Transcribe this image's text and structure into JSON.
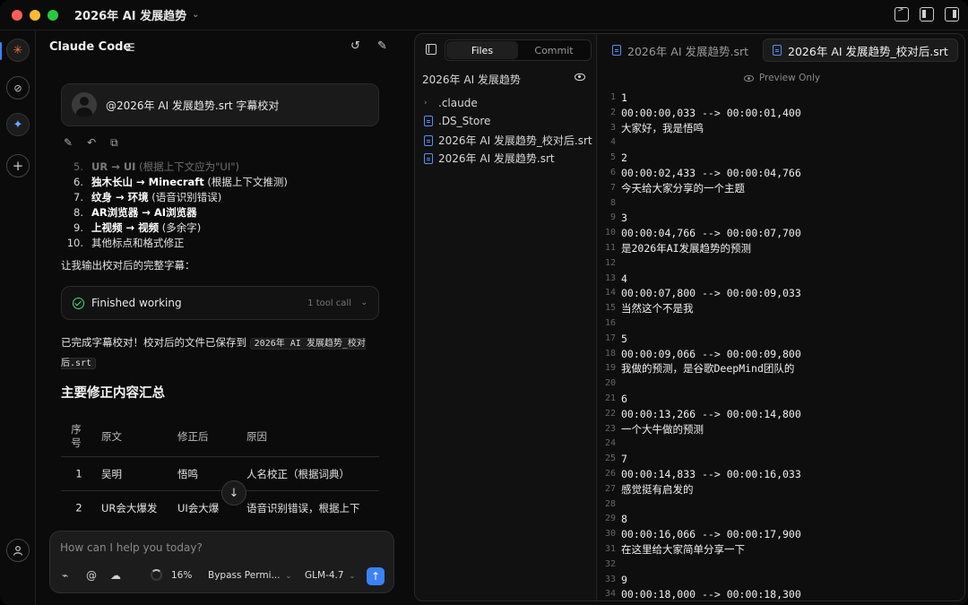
{
  "window": {
    "title": "2026年 AI 发展趋势"
  },
  "chat": {
    "title": "Claude Code",
    "user_message": "@2026年 AI 发展趋势.srt 字幕校对",
    "list": [
      {
        "num": "5.",
        "before": "UR → UI",
        "after": " (根据上下文应为\"UI\")",
        "faded": true
      },
      {
        "num": "6.",
        "before": "独木长山 → Minecraft",
        "after": " (根据上下文推测)"
      },
      {
        "num": "7.",
        "before": "纹身 → 环境",
        "after": " (语音识别错误)"
      },
      {
        "num": "8.",
        "before": "AR浏览器 → AI浏览器",
        "after": ""
      },
      {
        "num": "9.",
        "before": "上视频 → 视频",
        "after": " (多余字)"
      },
      {
        "num": "10.",
        "before": "",
        "after": "其他标点和格式修正"
      }
    ],
    "para1": "让我输出校对后的完整字幕：",
    "tool": {
      "label": "Finished working",
      "count": "1 tool call"
    },
    "para2_text": "已完成字幕校对！校对后的文件已保存到 ",
    "para2_code": "2026年 AI 发展趋势_校对后.srt",
    "heading": "主要修正内容汇总",
    "table": {
      "headers": [
        "序号",
        "原文",
        "修正后",
        "原因"
      ],
      "rows": [
        [
          "1",
          "吴明",
          "悟鸣",
          "人名校正（根据词典）"
        ],
        [
          "2",
          "UR会大爆发",
          "UI会大爆",
          "语音识别错误，根据上下"
        ]
      ]
    },
    "input": {
      "placeholder": "How can I help you today?",
      "context_pct": "16%",
      "mode": "Bypass Permi...",
      "model": "GLM-4.7"
    }
  },
  "panel": {
    "seg_files": "Files",
    "seg_commit": "Commit",
    "root": "2026年 AI 发展趋势",
    "tree": [
      {
        "name": ".claude",
        "type": "folder"
      },
      {
        "name": ".DS_Store",
        "type": "file"
      },
      {
        "name": "2026年 AI 发展趋势_校对后.srt",
        "type": "file"
      },
      {
        "name": "2026年 AI 发展趋势.srt",
        "type": "file"
      }
    ],
    "tabs": [
      "2026年 AI 发展趋势.srt",
      "2026年 AI 发展趋势_校对后.srt"
    ],
    "preview_label": "Preview Only",
    "lines": [
      "1",
      "00:00:00,033 --> 00:00:01,400",
      "大家好，我是悟鸣",
      "",
      "2",
      "00:00:02,433 --> 00:00:04,766",
      "今天给大家分享的一个主题",
      "",
      "3",
      "00:00:04,766 --> 00:00:07,700",
      "是2026年AI发展趋势的预测",
      "",
      "4",
      "00:00:07,800 --> 00:00:09,033",
      "当然这个不是我",
      "",
      "5",
      "00:00:09,066 --> 00:00:09,800",
      "我做的预测，是谷歌DeepMind团队的",
      "",
      "6",
      "00:00:13,266 --> 00:00:14,800",
      "一个大牛做的预测",
      "",
      "7",
      "00:00:14,833 --> 00:00:16,033",
      "感觉挺有启发的",
      "",
      "8",
      "00:00:16,066 --> 00:00:17,900",
      "在这里给大家简单分享一下",
      "",
      "9",
      "00:00:18,000 --> 00:00:18,300"
    ]
  }
}
